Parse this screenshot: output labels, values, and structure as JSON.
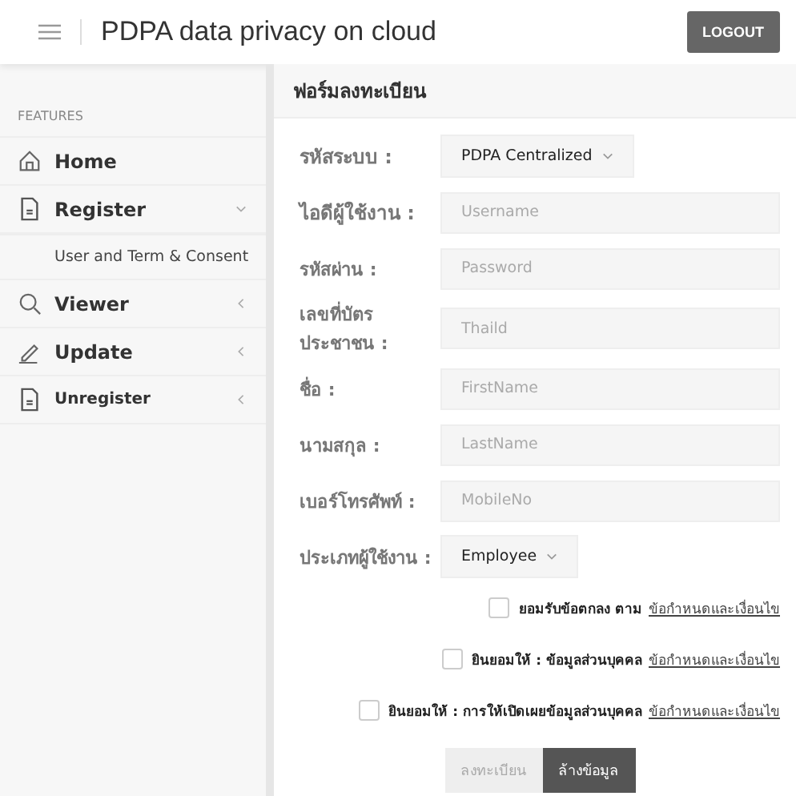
{
  "header": {
    "title": "PDPA data privacy on cloud",
    "logout": "LOGOUT"
  },
  "sidebar": {
    "section": "FEATURES",
    "items": [
      {
        "label": "Home",
        "kind": "home"
      },
      {
        "label": "Register",
        "kind": "document",
        "expanded": true,
        "children": [
          {
            "label": "User and Term & Consent"
          }
        ]
      },
      {
        "label": "Viewer",
        "kind": "search",
        "expanded": false
      },
      {
        "label": "Update",
        "kind": "pencil",
        "expanded": false
      },
      {
        "label": "Unregister",
        "kind": "document",
        "expanded": false
      }
    ]
  },
  "form": {
    "title": "ฟอร์มลงทะเบียน",
    "fields": [
      {
        "kind": "select",
        "label": "รหัสระบบ :",
        "value": "PDPA Centralized"
      },
      {
        "kind": "input",
        "label": "ไอดีผู้ใช้งาน :",
        "placeholder": "Username"
      },
      {
        "kind": "input",
        "label": "รหัสผ่าน :",
        "placeholder": "Password"
      },
      {
        "kind": "input",
        "label": "เลขที่บัตร ประชาชน :",
        "placeholder": "Thaild"
      },
      {
        "kind": "input",
        "label": "ชื่อ :",
        "placeholder": "FirstName"
      },
      {
        "kind": "input",
        "label": "นามสกุล :",
        "placeholder": "LastName"
      },
      {
        "kind": "input",
        "label": "เบอร์โทรศัพท์ :",
        "placeholder": "MobileNo"
      },
      {
        "kind": "select",
        "label": "ประเภทผู้ใช้งาน :",
        "value": "Employee"
      }
    ],
    "consents": [
      {
        "text": "ยอมรับข้อตกลง ตาม",
        "link": "ข้อกำหนดและเงื่อนไข",
        "checked": false
      },
      {
        "text": "ยินยอมให้ : ข้อมูลส่วนบุคคล",
        "link": "ข้อกำหนดและเงื่อนไข",
        "checked": false
      },
      {
        "text": "ยินยอมให้ : การให้เปิดเผยข้อมูลส่วนบุคคล",
        "link": "ข้อกำหนดและเงื่อนไข",
        "checked": false
      }
    ],
    "buttons": [
      {
        "label": "ลงทะเบียน",
        "disabled": true
      },
      {
        "label": "ล้างข้อมูล",
        "disabled": false
      }
    ]
  }
}
